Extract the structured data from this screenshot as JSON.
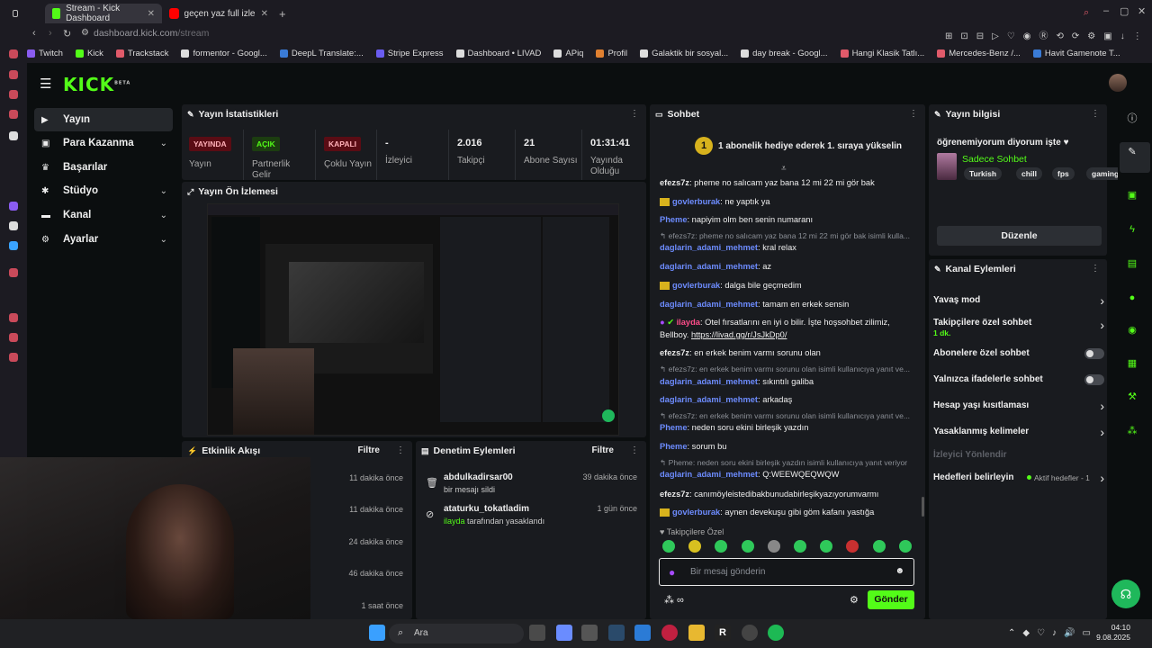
{
  "browser": {
    "tabs": [
      {
        "title": "Stream - Kick Dashboard",
        "icon": "kick-icon"
      },
      {
        "title": "geçen yaz full izle - YouTube",
        "icon": "youtube-icon"
      }
    ],
    "url_domain": "dashboard.kick.com",
    "url_path": "/stream",
    "bookmarks": [
      "Twitch",
      "Kick",
      "Trackstack",
      "formentor - Googl...",
      "DeepL Translate:...",
      "Stripe Express",
      "Dashboard • LIVAD",
      "APiq",
      "Profil",
      "Galaktik bir sosyal...",
      "day break - Googl...",
      "Hangi Klasik Tatlı...",
      "Mercedes-Benz /...",
      "Havit Gamenote T..."
    ]
  },
  "app": {
    "logo": "KICK",
    "logo_sup": "BETA",
    "nav": [
      {
        "label": "Yayın",
        "icon": "video-icon",
        "has_chevron": false
      },
      {
        "label": "Para Kazanma",
        "icon": "money-icon",
        "has_chevron": true
      },
      {
        "label": "Başarılar",
        "icon": "trophy-icon",
        "has_chevron": false
      },
      {
        "label": "Stüdyo",
        "icon": "studio-icon",
        "has_chevron": true
      },
      {
        "label": "Kanal",
        "icon": "tv-icon",
        "has_chevron": true
      },
      {
        "label": "Ayarlar",
        "icon": "gear-icon",
        "has_chevron": true
      }
    ]
  },
  "stats": {
    "title": "Yayın İstatistikleri",
    "items": [
      {
        "badge": "YAYINDA",
        "label": "Yayın",
        "color": "#e0182d"
      },
      {
        "badge": "AÇIK",
        "label": "Partnerlik Gelir",
        "color": "#53fc18"
      },
      {
        "badge": "KAPALI",
        "label": "Çoklu Yayın",
        "color": "#e0182d"
      },
      {
        "value": "-",
        "label": "İzleyici"
      },
      {
        "value": "2.016",
        "label": "Takipçi"
      },
      {
        "value": "21",
        "label": "Abone Sayısı"
      },
      {
        "value": "01:31:41",
        "label": "Yayında Olduğu"
      }
    ]
  },
  "preview": {
    "title": "Yayın Ön İzlemesi"
  },
  "activity": {
    "title": "Etkinlik Akışı",
    "filter": "Filtre",
    "times": [
      "11 dakika önce",
      "11 dakika önce",
      "24 dakika önce",
      "46 dakika önce",
      "1 saat önce"
    ]
  },
  "moderation": {
    "title": "Denetim Eylemleri",
    "filter": "Filtre",
    "items": [
      {
        "user": "abdulkadirsar00",
        "desc": "bir mesajı sildi",
        "time": "39 dakika önce",
        "icon": "trash-icon"
      },
      {
        "user": "ataturku_tokatladim",
        "desc_user": "ilayda",
        "desc": " tarafından yasaklandı",
        "time": "1 gün önce",
        "icon": "ban-icon"
      }
    ]
  },
  "chat": {
    "title": "Sohbet",
    "pinned": "1 abonelik hediye ederek 1. sıraya yükselin",
    "pinned_rank": "1",
    "messages": [
      {
        "user": "efezs7z",
        "text": ": pheme no salıcam yaz bana 12 mi 22 mi gör bak",
        "color": "#e8e8e8"
      },
      {
        "user": "govlerburak",
        "text": ": ne yaptık ya",
        "color": "#6d8cff",
        "badge": true
      },
      {
        "user": "Pheme",
        "text": ": napiyim olm ben senin numaranı",
        "color": "#6d8cff"
      },
      {
        "reply": "efezs7z: pheme no salıcam yaz bana 12 mi 22 mi gör bak isimli kulla..."
      },
      {
        "user": "daglarin_adami_mehmet",
        "text": ": kral relax",
        "color": "#6d8cff"
      },
      {
        "user": "daglarin_adami_mehmet",
        "text": ": az",
        "color": "#6d8cff"
      },
      {
        "user": "govlerburak",
        "text": ": dalga bile geçmedim",
        "color": "#6d8cff",
        "badge": true
      },
      {
        "user": "daglarin_adami_mehmet",
        "text": ": tamam en erkek sensin",
        "color": "#6d8cff"
      },
      {
        "user": "ilayda",
        "text": ": Otel fırsatlarını en iyi o bilir. İşte hoşsohbet zilimiz,",
        "color": "#ff4d8a",
        "mod": true
      },
      {
        "user": "",
        "text": "Bellboy. ",
        "link": "https://livad.gg/r/JsJkDp0/",
        "color": "#e8e8e8"
      },
      {
        "user": "efezs7z",
        "text": ": en erkek benim varmı sorunu olan",
        "color": "#e8e8e8"
      },
      {
        "reply": "efezs7z: en erkek benim varmı sorunu olan isimli kullanıcıya yanıt ve..."
      },
      {
        "user": "daglarin_adami_mehmet",
        "text": ": sıkıntılı galiba",
        "color": "#6d8cff"
      },
      {
        "user": "daglarin_adami_mehmet",
        "text": ": arkadaş",
        "color": "#6d8cff"
      },
      {
        "reply": "efezs7z: en erkek benim varmı sorunu olan isimli kullanıcıya yanıt ve..."
      },
      {
        "user": "Pheme",
        "text": ": neden soru ekini birleşik yazdın",
        "color": "#6d8cff"
      },
      {
        "user": "Pheme",
        "text": ": sorum bu",
        "color": "#6d8cff"
      },
      {
        "reply": "Pheme: neden soru ekini birleşik yazdın isimli kullanıcıya yanıt veriyor"
      },
      {
        "user": "daglarin_adami_mehmet",
        "text": ": Q:WEEWQEQWQW",
        "color": "#6d8cff"
      },
      {
        "user": "efezs7z",
        "text": ": canımöyleistedibakbunudabirleşikyazıyorumvarmı",
        "color": "#e8e8e8"
      },
      {
        "user": "govlerburak",
        "text": ": aynen devekuşu gibi göm kafanı yastığa",
        "color": "#6d8cff",
        "badge": true
      }
    ],
    "followers_only": "Takipçilere Özel",
    "input_placeholder": "Bir mesaj gönderin",
    "send": "Gönder"
  },
  "stream_info": {
    "title": "Yayın bilgisi",
    "stream_title": "öğrenemiyorum diyorum işte ♥",
    "category": "Sadece Sohbet",
    "tags": [
      "Turkish",
      "chill",
      "fps",
      "gaming"
    ],
    "edit": "Düzenle"
  },
  "channel_actions": {
    "title": "Kanal Eylemleri",
    "items": [
      {
        "label": "Yavaş mod",
        "type": "chevron"
      },
      {
        "label": "Takipçilere özel sohbet",
        "sub": "1 dk.",
        "type": "chevron"
      },
      {
        "label": "Abonelere özel sohbet",
        "type": "toggle"
      },
      {
        "label": "Yalnızca ifadelerle sohbet",
        "type": "toggle"
      },
      {
        "label": "Hesap yaşı kısıtlaması",
        "type": "chevron"
      },
      {
        "label": "Yasaklanmış kelimeler",
        "type": "chevron"
      },
      {
        "label": "İzleyici Yönlendir",
        "type": "disabled"
      },
      {
        "label": "Hedefleri belirleyin",
        "status": "Aktif hedefler - 1",
        "type": "chevron"
      }
    ]
  },
  "taskbar": {
    "search": "Ara",
    "time": "04:10",
    "date": "9.08.2025"
  }
}
